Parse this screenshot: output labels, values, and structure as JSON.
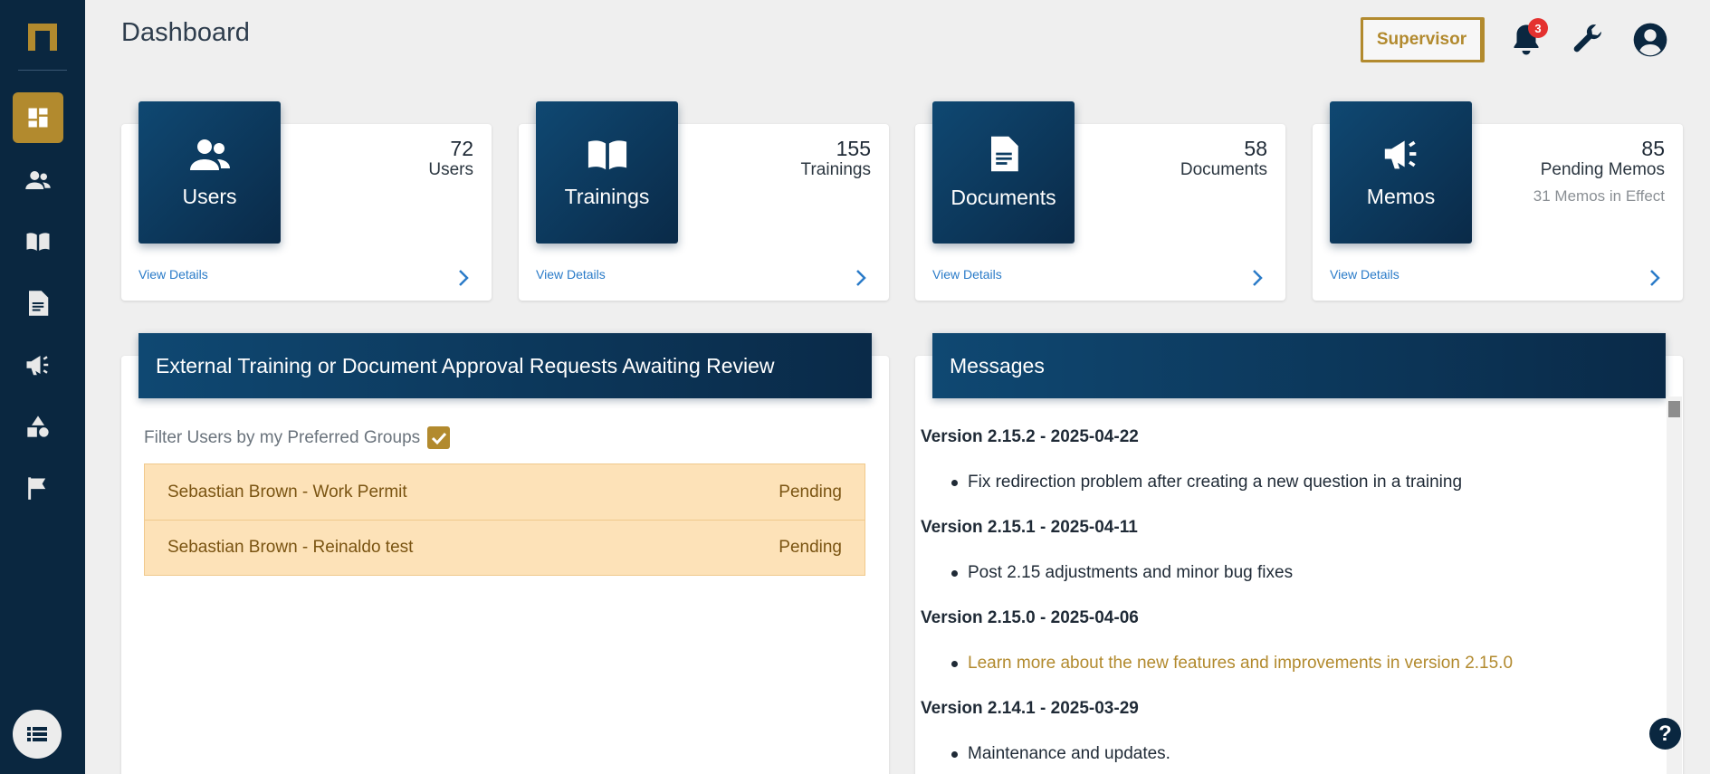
{
  "header": {
    "title": "Dashboard",
    "role_label": "Supervisor",
    "notification_count": "3"
  },
  "sidebar": {
    "items": [
      {
        "name": "dashboard",
        "icon": "dashboard-icon",
        "active": true
      },
      {
        "name": "users",
        "icon": "users-icon"
      },
      {
        "name": "trainings",
        "icon": "book-icon"
      },
      {
        "name": "documents",
        "icon": "document-icon"
      },
      {
        "name": "memos",
        "icon": "megaphone-icon"
      },
      {
        "name": "shapes",
        "icon": "shapes-icon"
      },
      {
        "name": "flag",
        "icon": "flag-icon"
      }
    ],
    "bottom_icon": "list-icon"
  },
  "cards": [
    {
      "title": "Users",
      "count": "72",
      "sub": "Users",
      "sub2": "",
      "link": "View Details"
    },
    {
      "title": "Trainings",
      "count": "155",
      "sub": "Trainings",
      "sub2": "",
      "link": "View Details"
    },
    {
      "title": "Documents",
      "count": "58",
      "sub": "Documents",
      "sub2": "",
      "link": "View Details"
    },
    {
      "title": "Memos",
      "count": "85",
      "sub": "Pending Memos",
      "sub2": "31 Memos in Effect",
      "link": "View Details"
    }
  ],
  "requests_panel": {
    "title": "External Training or Document Approval Requests Awaiting Review",
    "filter_label": "Filter Users by my Preferred Groups",
    "filter_checked": true,
    "rows": [
      {
        "name": "Sebastian Brown - Work Permit",
        "status": "Pending"
      },
      {
        "name": "Sebastian Brown - Reinaldo test",
        "status": "Pending"
      }
    ]
  },
  "messages_panel": {
    "title": "Messages",
    "entries": [
      {
        "version": "Version 2.15.2 - 2025-04-22",
        "item": "Fix redirection problem after creating a new question in a training"
      },
      {
        "version": "Version 2.15.1 - 2025-04-11",
        "item": "Post 2.15 adjustments and minor bug fixes"
      },
      {
        "version": "Version 2.15.0 - 2025-04-06",
        "item": "Learn more about the new features and improvements in version 2.15.0"
      },
      {
        "version": "Version 2.14.1 - 2025-03-29",
        "item": "Maintenance and updates."
      }
    ]
  },
  "help_label": "?",
  "colors": {
    "sidebar": "#0a2740",
    "accent_gold": "#b28a2e",
    "tile_blue": "#0f4872",
    "link_blue": "#2a7bc8",
    "pending_bg": "#fde2b8",
    "badge_red": "#e4312f"
  }
}
